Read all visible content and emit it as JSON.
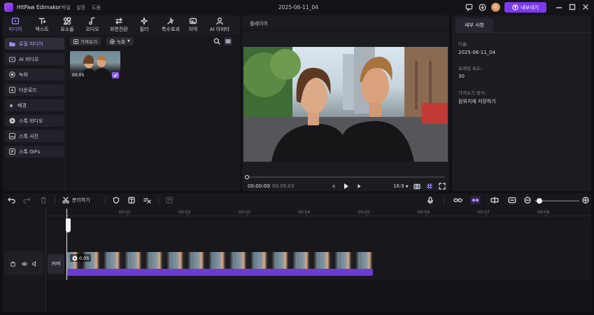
{
  "app": {
    "title": "HitPaw Edimakor",
    "menu": [
      "파일",
      "설정",
      "도움"
    ],
    "project_name": "2025-06-11_04",
    "export_label": "내보내기"
  },
  "top_tabs": [
    {
      "label": "미디어",
      "icon": "media-folder-icon"
    },
    {
      "label": "텍스트",
      "icon": "text-icon"
    },
    {
      "label": "요소들",
      "icon": "elements-icon"
    },
    {
      "label": "오디오",
      "icon": "audio-note-icon"
    },
    {
      "label": "화면전환",
      "icon": "transition-icon"
    },
    {
      "label": "필터",
      "icon": "filter-icon"
    },
    {
      "label": "특수효과",
      "icon": "effects-icon"
    },
    {
      "label": "자막",
      "icon": "subtitle-icon"
    },
    {
      "label": "AI 아바타",
      "icon": "avatar-icon"
    }
  ],
  "sidebar": {
    "items": [
      {
        "label": "로컬 미디어",
        "icon": "folder-icon"
      },
      {
        "label": "AI 비디오",
        "icon": "ai-video-icon"
      },
      {
        "label": "녹화",
        "icon": "record-icon"
      },
      {
        "label": "다운로드",
        "icon": "download-icon"
      },
      {
        "label": "배경",
        "icon": "background-icon"
      },
      {
        "label": "스톡 비디오",
        "icon": "stock-video-icon"
      },
      {
        "label": "스톡 사진",
        "icon": "stock-photo-icon"
      },
      {
        "label": "스톡 GIFs",
        "icon": "gif-icon"
      }
    ]
  },
  "media": {
    "import_label": "가져오기",
    "record_label": "녹화",
    "clip_duration": "00:05"
  },
  "player": {
    "title": "플레이어",
    "current_time": "00:00:00",
    "separator": "/",
    "total_time": "00:05:03",
    "aspect": "16:9",
    "progress": 0
  },
  "properties": {
    "tab": "세부 사항",
    "name_label": "이름:",
    "name_value": "2025-06-11_04",
    "fps_label": "프레임 속도:",
    "fps_value": "30",
    "import_label": "가져오기 방식:",
    "import_value": "원위치에 저장하기"
  },
  "timeline": {
    "split_label": "분리하기",
    "ticks": [
      "00:00",
      "00:01",
      "00:02",
      "00:03",
      "00:04",
      "00:05",
      "00:06",
      "00:07",
      "00:08"
    ],
    "cover_label": "커버",
    "clip_duration": "0.05"
  },
  "colors": {
    "accent": "#8b5cf6",
    "export_bg": "#7c3aed",
    "clip_bar": "#6d3bd1"
  }
}
